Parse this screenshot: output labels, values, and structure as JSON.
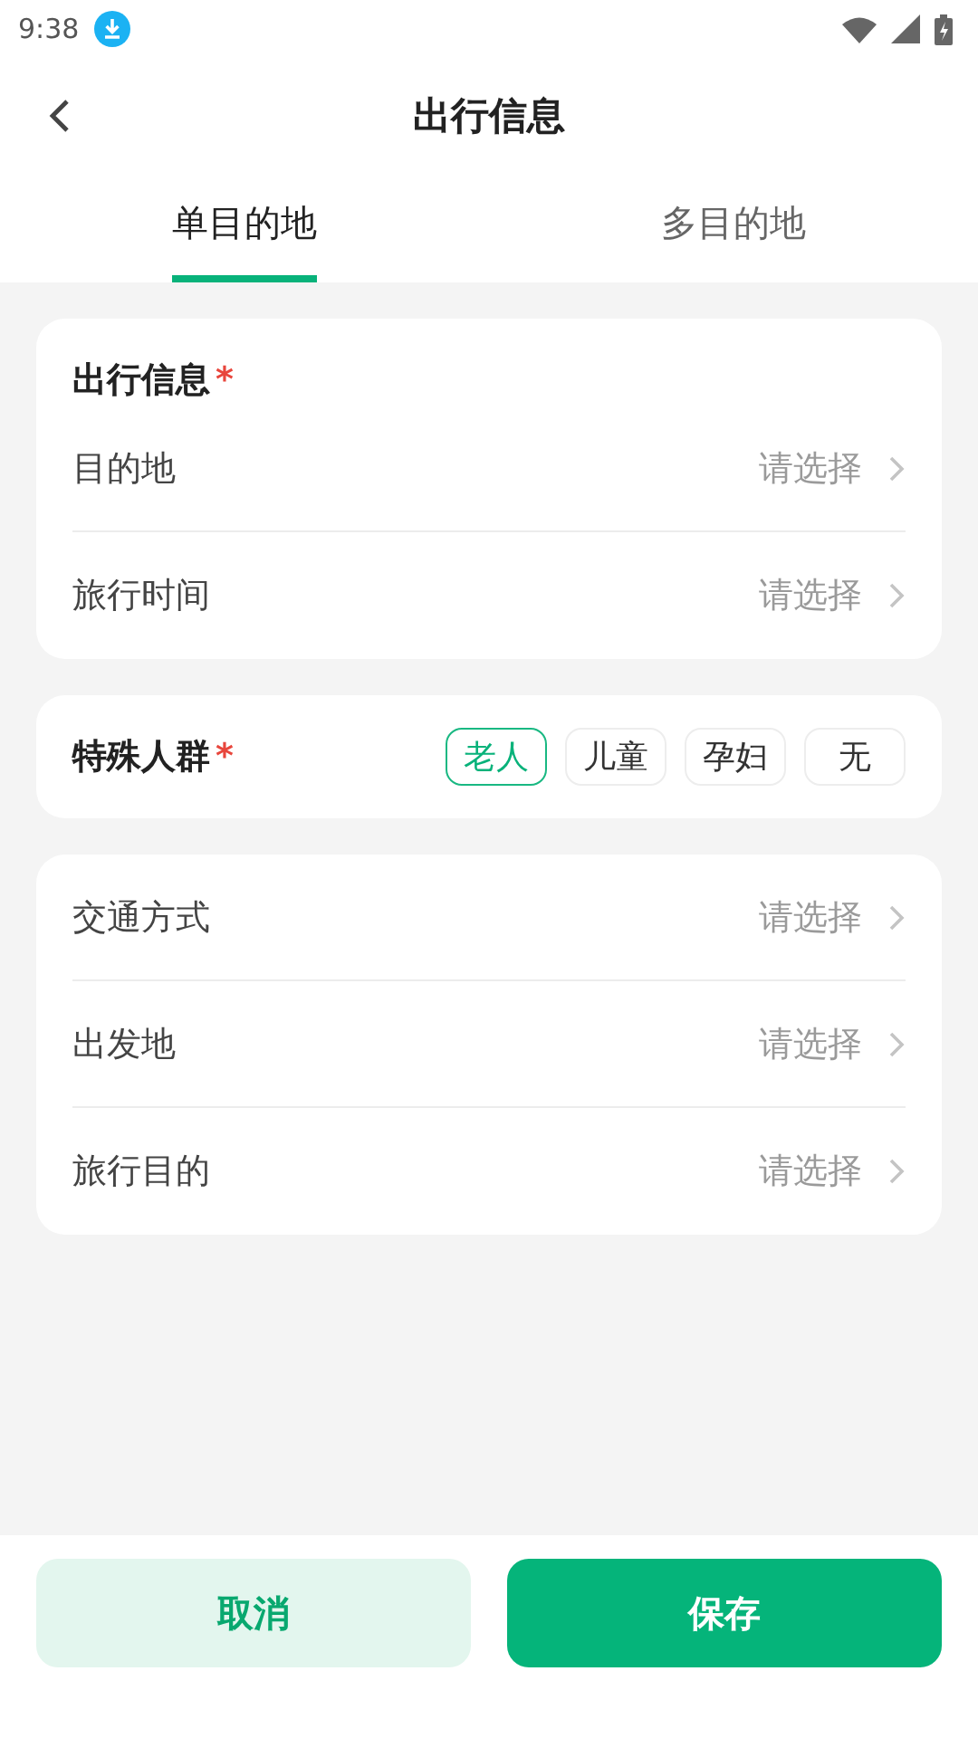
{
  "status_bar": {
    "time": "9:38"
  },
  "header": {
    "title": "出行信息"
  },
  "tabs": [
    {
      "label": "单目的地",
      "selected": true
    },
    {
      "label": "多目的地",
      "selected": false
    }
  ],
  "sections": [
    {
      "kind": "list",
      "title": "出行信息",
      "required_mark": "*",
      "rows": [
        {
          "label": "目的地",
          "placeholder": "请选择"
        },
        {
          "label": "旅行时间",
          "placeholder": "请选择"
        }
      ]
    },
    {
      "kind": "chips",
      "title": "特殊人群",
      "required_mark": "*",
      "chips": [
        {
          "label": "老人",
          "selected": true
        },
        {
          "label": "儿童",
          "selected": false
        },
        {
          "label": "孕妇",
          "selected": false
        },
        {
          "label": "无",
          "selected": false
        }
      ]
    },
    {
      "kind": "list",
      "rows": [
        {
          "label": "交通方式",
          "placeholder": "请选择"
        },
        {
          "label": "出发地",
          "placeholder": "请选择"
        },
        {
          "label": "旅行目的",
          "placeholder": "请选择"
        }
      ]
    }
  ],
  "buttons": [
    {
      "label": "取消",
      "kind": "secondary"
    },
    {
      "label": "保存",
      "kind": "primary"
    }
  ]
}
